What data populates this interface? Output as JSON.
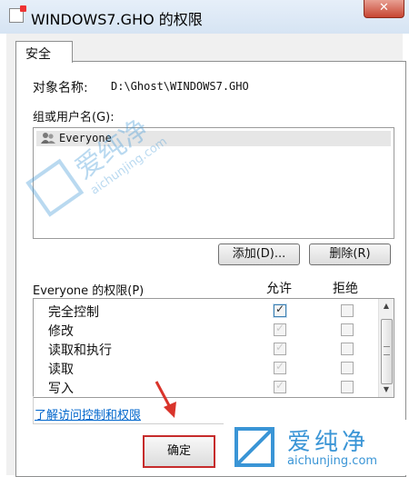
{
  "window": {
    "title": "WINDOWS7.GHO 的权限",
    "close_glyph": "✕"
  },
  "tabs": [
    {
      "label": "安全"
    }
  ],
  "object": {
    "label": "对象名称:",
    "value": "D:\\Ghost\\WINDOWS7.GHO"
  },
  "groups": {
    "label": "组或用户名(G):",
    "items": [
      {
        "name": "Everyone",
        "icon": "users-icon"
      }
    ],
    "add_button": "添加(D)...",
    "remove_button": "删除(R)"
  },
  "permissions": {
    "label": "Everyone 的权限(P)",
    "allow_header": "允许",
    "deny_header": "拒绝",
    "rows": [
      {
        "name": "完全控制",
        "allow": true,
        "deny": false
      },
      {
        "name": "修改",
        "allow": true,
        "deny": false
      },
      {
        "name": "读取和执行",
        "allow": true,
        "deny": false
      },
      {
        "name": "读取",
        "allow": true,
        "deny": false
      },
      {
        "name": "写入",
        "allow": true,
        "deny": false
      }
    ]
  },
  "link": "了解访问控制和权限",
  "buttons": {
    "ok": "确定"
  },
  "watermark": {
    "cn": "爱纯净",
    "en": "aichunjing.com",
    "color": "#3a95d6"
  }
}
